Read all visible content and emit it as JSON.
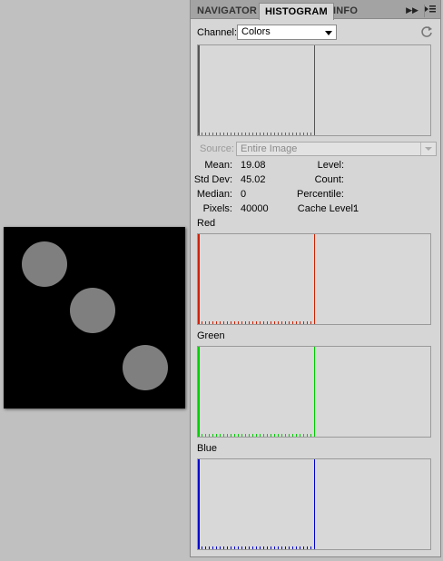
{
  "panel": {
    "tabs": [
      {
        "label": "NAVIGATOR",
        "active": false
      },
      {
        "label": "HISTOGRAM",
        "active": true
      },
      {
        "label": "INFO",
        "active": false
      }
    ],
    "expand_icon": "double-arrow-right-icon",
    "menu_icon": "panel-menu-icon"
  },
  "channel": {
    "label": "Channel:",
    "value": "Colors"
  },
  "source": {
    "label": "Source:",
    "value": "Entire Image"
  },
  "stats": {
    "mean_label": "Mean:",
    "mean_value": "19.08",
    "stddev_label": "Std Dev:",
    "stddev_value": "45.02",
    "median_label": "Median:",
    "median_value": "0",
    "pixels_label": "Pixels:",
    "pixels_value": "40000",
    "level_label": "Level:",
    "level_value": "",
    "count_label": "Count:",
    "count_value": "",
    "percentile_label": "Percentile:",
    "percentile_value": "",
    "cache_label": "Cache Level:",
    "cache_value": "1"
  },
  "channels": [
    {
      "name": "Red",
      "color": "#cc2200"
    },
    {
      "name": "Green",
      "color": "#00cc00"
    },
    {
      "name": "Blue",
      "color": "#0000cc"
    }
  ],
  "composite_color": "#555555",
  "canvas": {
    "background": "#000000",
    "circle_color": "#7f7f7f",
    "circle_count": 3
  }
}
